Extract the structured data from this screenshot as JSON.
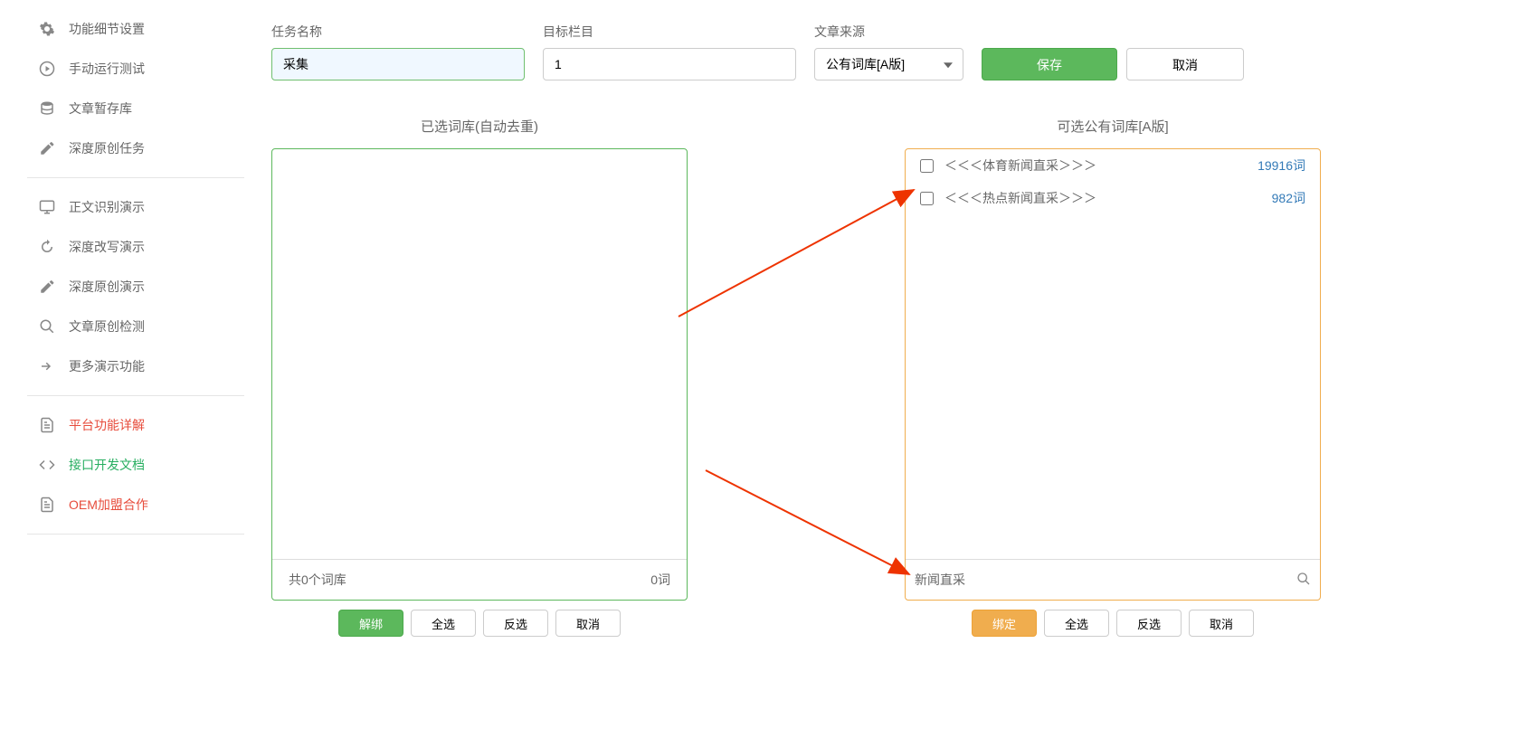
{
  "sidebar": {
    "items": [
      {
        "label": "功能细节设置",
        "icon": "gears"
      },
      {
        "label": "手动运行测试",
        "icon": "play"
      },
      {
        "label": "文章暂存库",
        "icon": "database"
      },
      {
        "label": "深度原创任务",
        "icon": "edit"
      }
    ],
    "demo_items": [
      {
        "label": "正文识别演示",
        "icon": "monitor"
      },
      {
        "label": "深度改写演示",
        "icon": "refresh"
      },
      {
        "label": "深度原创演示",
        "icon": "edit"
      },
      {
        "label": "文章原创检测",
        "icon": "search"
      },
      {
        "label": "更多演示功能",
        "icon": "share"
      }
    ],
    "link_items": [
      {
        "label": "平台功能详解",
        "icon": "doc",
        "color": "red"
      },
      {
        "label": "接口开发文档",
        "icon": "code",
        "color": "green"
      },
      {
        "label": "OEM加盟合作",
        "icon": "doc",
        "color": "red"
      }
    ]
  },
  "form": {
    "task_name_label": "任务名称",
    "task_name_value": "采集",
    "target_column_label": "目标栏目",
    "target_column_value": "1",
    "source_label": "文章来源",
    "source_value": "公有词库[A版]",
    "save_label": "保存",
    "cancel_label": "取消"
  },
  "left_panel": {
    "title": "已选词库(自动去重)",
    "footer_count": "共0个词库",
    "footer_words": "0词",
    "buttons": {
      "unbind": "解绑",
      "select_all": "全选",
      "invert": "反选",
      "cancel": "取消"
    }
  },
  "right_panel": {
    "title": "可选公有词库[A版]",
    "items": [
      {
        "name": "＜＜＜体育新闻直采＞＞＞",
        "count": "19916词"
      },
      {
        "name": "＜＜＜热点新闻直采＞＞＞",
        "count": "982词"
      }
    ],
    "search_value": "新闻直采",
    "buttons": {
      "bind": "绑定",
      "select_all": "全选",
      "invert": "反选",
      "cancel": "取消"
    }
  }
}
